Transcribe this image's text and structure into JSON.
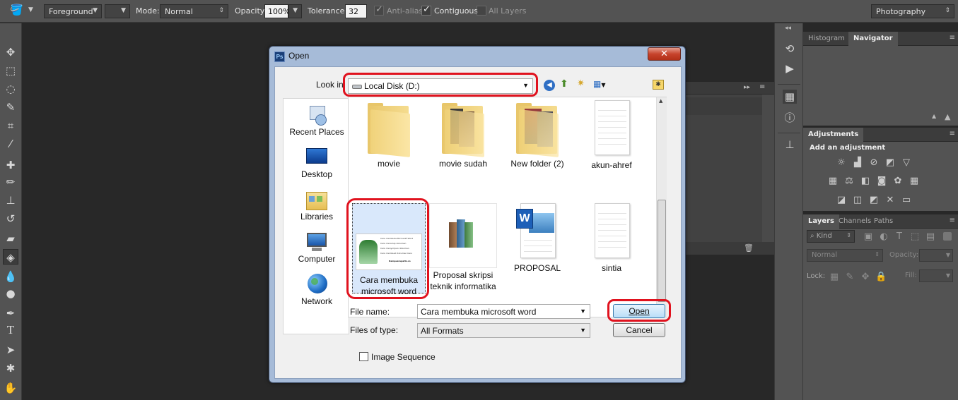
{
  "options_bar": {
    "fill_label": "Foreground",
    "mode_label": "Mode:",
    "mode_value": "Normal",
    "opacity_label": "Opacity:",
    "opacity_value": "100%",
    "tolerance_label": "Tolerance:",
    "tolerance_value": "32",
    "anti_alias": "Anti-alias",
    "contiguous": "Contiguous",
    "all_layers": "All Layers",
    "workspace": "Photography"
  },
  "panels": {
    "histogram_tab": "Histogram",
    "navigator_tab": "Navigator",
    "adjustments_tab": "Adjustments",
    "adjustments_title": "Add an adjustment",
    "layers_tab": "Layers",
    "channels_tab": "Channels",
    "paths_tab": "Paths",
    "kind_label": "Kind",
    "blend_mode": "Normal",
    "opacity_label": "Opacity:",
    "lock_label": "Lock:",
    "fill_label": "Fill:"
  },
  "dialog": {
    "title": "Open",
    "look_in_label": "Look in:",
    "look_in_value": "Local Disk (D:)",
    "places": [
      {
        "label": "Recent Places",
        "icon": "recent-places-icon"
      },
      {
        "label": "Desktop",
        "icon": "desktop-icon"
      },
      {
        "label": "Libraries",
        "icon": "libraries-icon"
      },
      {
        "label": "Computer",
        "icon": "computer-icon"
      },
      {
        "label": "Network",
        "icon": "network-icon"
      }
    ],
    "files": [
      {
        "label": "movie",
        "type": "folder"
      },
      {
        "label": "movie sudah",
        "type": "folder"
      },
      {
        "label": "New folder (2)",
        "type": "folder"
      },
      {
        "label": "akun-ahref",
        "type": "text-document"
      },
      {
        "label": "Cara membuka microsoft word",
        "type": "image"
      },
      {
        "label": "Proposal skripsi teknik informatika",
        "type": "books"
      },
      {
        "label": "PROPOSAL",
        "type": "word-document"
      },
      {
        "label": "sintia",
        "type": "text-document"
      }
    ],
    "file_name_label": "File name:",
    "file_name_value": "Cara membuka microsoft word",
    "files_of_type_label": "Files of type:",
    "files_of_type_value": "All Formats",
    "open_button": "Open",
    "cancel_button": "Cancel",
    "image_sequence_label": "Image Sequence",
    "thumb_lines": [
      "Cara membuka Microsoft Word",
      "Cara menutup dokumen",
      "Cara menyimpan dokumen",
      "Cara membuat dokumen baru",
      "Kampusrupatix.co"
    ]
  },
  "highlight_color": "#e0121e"
}
